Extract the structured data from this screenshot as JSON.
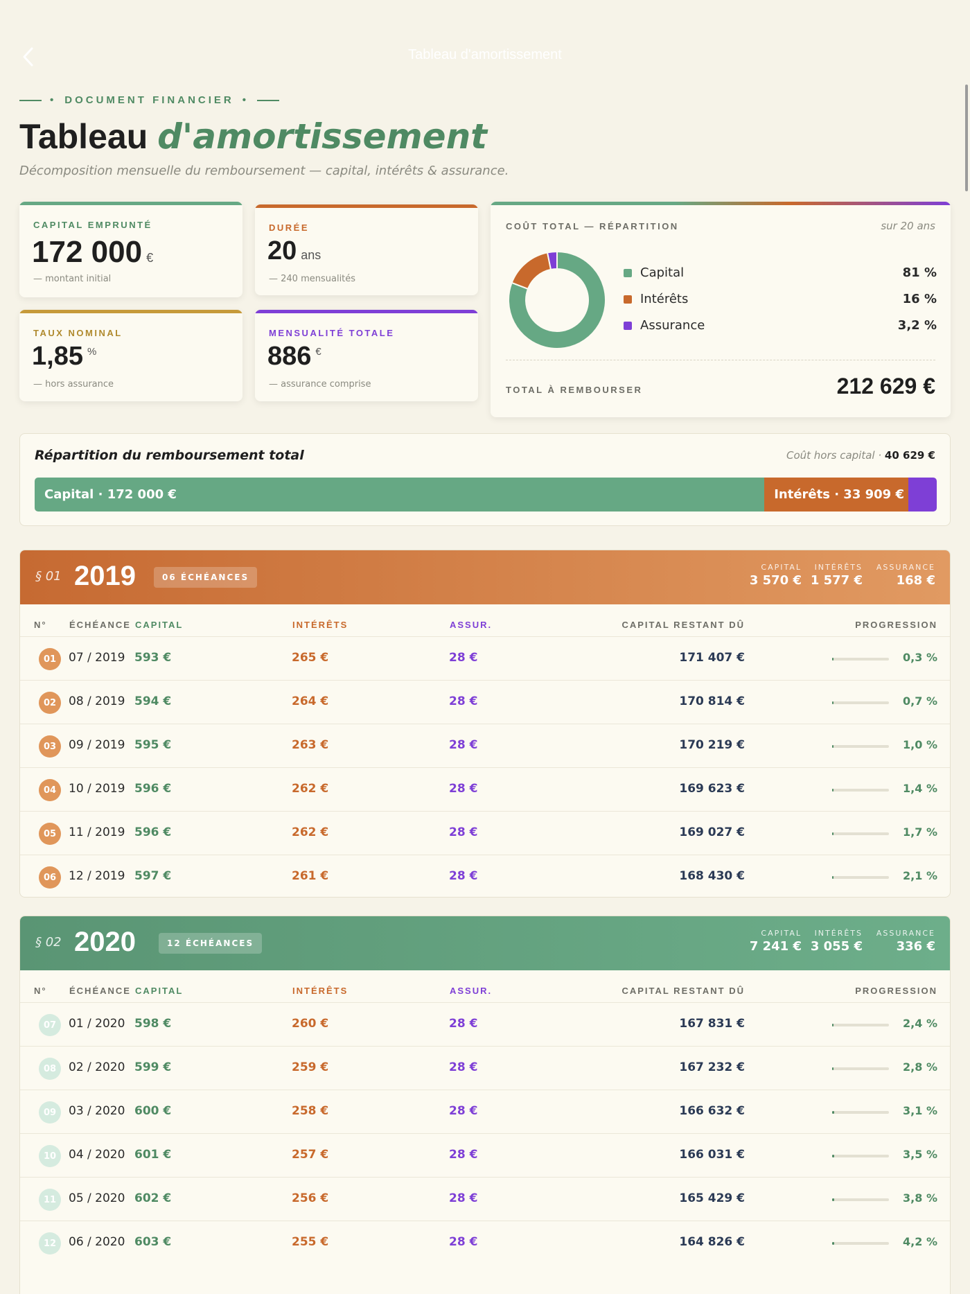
{
  "nav": {
    "title": "Tableau d'amortissement"
  },
  "header": {
    "eyebrow": "DOCUMENT FINANCIER",
    "title_main": "Tableau",
    "title_accent": "d'amortissement",
    "subtitle": "Décomposition mensuelle du remboursement — capital, intérêts & assurance."
  },
  "colors": {
    "capital": "#66a884",
    "interets": "#c8692c",
    "assurance": "#7e3fd6",
    "taux": "#c69a3a"
  },
  "kpis": {
    "capital": {
      "label": "CAPITAL EMPRUNTÉ",
      "value": "172 000",
      "unit": "€",
      "note": "— montant initial"
    },
    "duree": {
      "label": "DURÉE",
      "value": "20",
      "unit": "ans",
      "note": "— 240 mensualités"
    },
    "taux": {
      "label": "TAUX NOMINAL",
      "value": "1,85",
      "unit": "%",
      "note": "— hors assurance"
    },
    "mensualite": {
      "label": "MENSUALITÉ TOTALE",
      "value": "886",
      "unit": "€",
      "note": "— assurance comprise"
    }
  },
  "cost": {
    "header": "COÛT TOTAL — RÉPARTITION",
    "period": "sur 20 ans",
    "legend": [
      {
        "name": "Capital",
        "pct": "81 %",
        "value": 81
      },
      {
        "name": "Intérêts",
        "pct": "16 %",
        "value": 16
      },
      {
        "name": "Assurance",
        "pct": "3,2 %",
        "value": 3.2
      }
    ],
    "total_label": "TOTAL À REMBOURSER",
    "total_value": "212 629 €"
  },
  "split": {
    "title": "Répartition du remboursement total",
    "right_label": "Coût hors capital ·",
    "right_value": "40 629 €",
    "capital_label": "Capital · 172 000 €",
    "interets_label": "Intérêts · 33 909 €",
    "capital_value": 172000,
    "interets_value": 33909,
    "assurance_value": 6720
  },
  "table": {
    "columns": {
      "num": "N°",
      "date": "ÉCHÉANCE",
      "capital": "CAPITAL",
      "interets": "INTÉRÊTS",
      "assurance": "ASSUR.",
      "restant": "CAPITAL RESTANT DÛ",
      "progression": "PROGRESSION"
    }
  },
  "years": [
    {
      "section": "§ 01",
      "year": "2019",
      "badge": "06 ÉCHÉANCES",
      "totals": {
        "capital_label": "CAPITAL",
        "capital": "3 570 €",
        "interets_label": "INTÉRÊTS",
        "interets": "1 577 €",
        "assurance_label": "ASSURANCE",
        "assurance": "168 €"
      },
      "rows": [
        {
          "n": "01",
          "date": "07 / 2019",
          "capital": "593 €",
          "interets": "265 €",
          "assurance": "28 €",
          "restant": "171 407 €",
          "pct": "0,3 %",
          "progress": 0.003
        },
        {
          "n": "02",
          "date": "08 / 2019",
          "capital": "594 €",
          "interets": "264 €",
          "assurance": "28 €",
          "restant": "170 814 €",
          "pct": "0,7 %",
          "progress": 0.007
        },
        {
          "n": "03",
          "date": "09 / 2019",
          "capital": "595 €",
          "interets": "263 €",
          "assurance": "28 €",
          "restant": "170 219 €",
          "pct": "1,0 %",
          "progress": 0.01
        },
        {
          "n": "04",
          "date": "10 / 2019",
          "capital": "596 €",
          "interets": "262 €",
          "assurance": "28 €",
          "restant": "169 623 €",
          "pct": "1,4 %",
          "progress": 0.014
        },
        {
          "n": "05",
          "date": "11 / 2019",
          "capital": "596 €",
          "interets": "262 €",
          "assurance": "28 €",
          "restant": "169 027 €",
          "pct": "1,7 %",
          "progress": 0.017
        },
        {
          "n": "06",
          "date": "12 / 2019",
          "capital": "597 €",
          "interets": "261 €",
          "assurance": "28 €",
          "restant": "168 430 €",
          "pct": "2,1 %",
          "progress": 0.021
        }
      ]
    },
    {
      "section": "§ 02",
      "year": "2020",
      "badge": "12 ÉCHÉANCES",
      "totals": {
        "capital_label": "CAPITAL",
        "capital": "7 241 €",
        "interets_label": "INTÉRÊTS",
        "interets": "3 055 €",
        "assurance_label": "ASSURANCE",
        "assurance": "336 €"
      },
      "rows": [
        {
          "n": "07",
          "date": "01 / 2020",
          "capital": "598 €",
          "interets": "260 €",
          "assurance": "28 €",
          "restant": "167 831 €",
          "pct": "2,4 %",
          "progress": 0.024
        },
        {
          "n": "08",
          "date": "02 / 2020",
          "capital": "599 €",
          "interets": "259 €",
          "assurance": "28 €",
          "restant": "167 232 €",
          "pct": "2,8 %",
          "progress": 0.028
        },
        {
          "n": "09",
          "date": "03 / 2020",
          "capital": "600 €",
          "interets": "258 €",
          "assurance": "28 €",
          "restant": "166 632 €",
          "pct": "3,1 %",
          "progress": 0.031
        },
        {
          "n": "10",
          "date": "04 / 2020",
          "capital": "601 €",
          "interets": "257 €",
          "assurance": "28 €",
          "restant": "166 031 €",
          "pct": "3,5 %",
          "progress": 0.035
        },
        {
          "n": "11",
          "date": "05 / 2020",
          "capital": "602 €",
          "interets": "256 €",
          "assurance": "28 €",
          "restant": "165 429 €",
          "pct": "3,8 %",
          "progress": 0.038
        },
        {
          "n": "12",
          "date": "06 / 2020",
          "capital": "603 €",
          "interets": "255 €",
          "assurance": "28 €",
          "restant": "164 826 €",
          "pct": "4,2 %",
          "progress": 0.042
        }
      ]
    }
  ]
}
